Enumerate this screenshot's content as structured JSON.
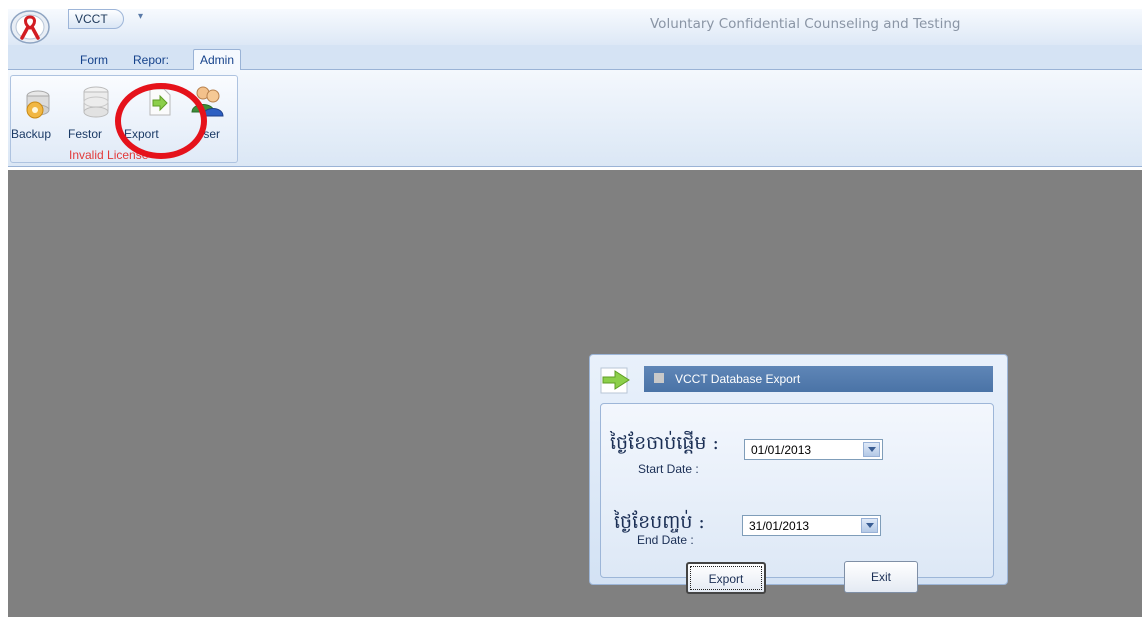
{
  "app": {
    "orb_icon": "aids-ribbon-icon",
    "qat_label": "VCCT",
    "qat_arrow": "▾",
    "window_title": "Voluntary Confidential Counseling and Testing"
  },
  "ribbon": {
    "tabs": [
      {
        "label": "Form",
        "active": false
      },
      {
        "label": "Repor:",
        "active": false
      },
      {
        "label": "Admin",
        "active": true
      }
    ],
    "group_caption": "Invalid License",
    "buttons": [
      {
        "label": "Backup",
        "icon": "backup-disk-icon"
      },
      {
        "label": "Festor",
        "icon": "restore-database-icon"
      },
      {
        "label": "Export",
        "icon": "export-arrow-icon"
      },
      {
        "label": "Iser",
        "icon": "user-icon"
      }
    ]
  },
  "dialog": {
    "title": "VCCT Database Export",
    "start_label_kh": "ថ្ងៃខែចាប់ផ្ដើម :",
    "start_label_en": "Start Date :",
    "start_value": "01/01/2013",
    "end_label_kh": "ថ្ងៃខែបញ្ចប់ :",
    "end_label_en": "End Date :",
    "end_value": "31/01/2013",
    "export_label": "Export",
    "exit_label": "Exit"
  },
  "colors": {
    "highlight": "#e5121b",
    "workspace": "#808080",
    "dialog_header": "#4a73a6",
    "license_warning": "#e23a3a"
  }
}
